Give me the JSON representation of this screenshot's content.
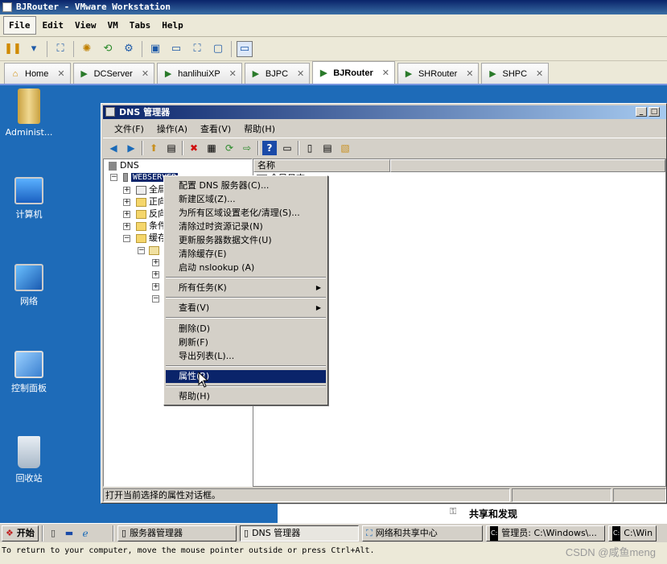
{
  "vmware": {
    "title": "BJRouter - VMware Workstation",
    "menu": [
      "File",
      "Edit",
      "View",
      "VM",
      "Tabs",
      "Help"
    ],
    "tabs": [
      {
        "label": "Home",
        "icon": "home-icon",
        "active": false
      },
      {
        "label": "DCServer",
        "icon": "vm-icon",
        "active": false
      },
      {
        "label": "hanlihuiXP",
        "icon": "vm-icon",
        "active": false
      },
      {
        "label": "BJPC",
        "icon": "vm-icon",
        "active": false
      },
      {
        "label": "BJRouter",
        "icon": "vm-icon",
        "active": true
      },
      {
        "label": "SHRouter",
        "icon": "vm-icon",
        "active": false
      },
      {
        "label": "SHPC",
        "icon": "vm-icon",
        "active": false
      }
    ],
    "hint": "To return to your computer, move the mouse pointer outside or press Ctrl+Alt."
  },
  "desktop": {
    "icons": [
      {
        "label": "Administ...",
        "icon": "user-folder-icon"
      },
      {
        "label": "计算机",
        "icon": "computer-icon"
      },
      {
        "label": "网络",
        "icon": "network-icon"
      },
      {
        "label": "控制面板",
        "icon": "control-panel-icon"
      },
      {
        "label": "回收站",
        "icon": "recycle-bin-icon"
      }
    ]
  },
  "dns_window": {
    "title": "DNS 管理器",
    "menu": [
      "文件(F)",
      "操作(A)",
      "查看(V)",
      "帮助(H)"
    ],
    "tree": {
      "root": "DNS",
      "server": "WEBSERVER",
      "children": [
        "全局",
        "正向",
        "反向",
        "条件",
        "缓存"
      ]
    },
    "list_header": "名称",
    "list_first_item": "全局日志",
    "status": "打开当前选择的属性对话框。"
  },
  "context_menu": {
    "items": [
      {
        "label": "配置 DNS 服务器(C)...",
        "submenu": false
      },
      {
        "label": "新建区域(Z)...",
        "submenu": false
      },
      {
        "label": "为所有区域设置老化/清理(S)...",
        "submenu": false
      },
      {
        "label": "清除过时资源记录(N)",
        "submenu": false
      },
      {
        "label": "更新服务器数据文件(U)",
        "submenu": false
      },
      {
        "label": "清除缓存(E)",
        "submenu": false
      },
      {
        "label": "启动 nslookup (A)",
        "submenu": false
      },
      {
        "label": "所有任务(K)",
        "submenu": true
      },
      {
        "label": "查看(V)",
        "submenu": true
      },
      {
        "label": "删除(D)",
        "submenu": false
      },
      {
        "label": "刷新(F)",
        "submenu": false
      },
      {
        "label": "导出列表(L)...",
        "submenu": false
      },
      {
        "label": "属性(R)",
        "submenu": false,
        "selected": true
      },
      {
        "label": "帮助(H)",
        "submenu": false
      }
    ]
  },
  "network_fragment": {
    "label": "共享和发现"
  },
  "taskbar": {
    "start": "开始",
    "buttons": [
      {
        "label": "服务器管理器",
        "active": false
      },
      {
        "label": "DNS 管理器",
        "active": true
      },
      {
        "label": "网络和共享中心",
        "active": false
      },
      {
        "label": "管理员: C:\\Windows\\...",
        "active": false
      },
      {
        "label": "C:\\Win",
        "active": false
      }
    ]
  },
  "watermark": "CSDN @咸鱼meng",
  "colors": {
    "desktop": "#1e6bb8",
    "title_active": "#0a246a",
    "menu_selected": "#0a246a",
    "chrome": "#d4d0c8"
  }
}
